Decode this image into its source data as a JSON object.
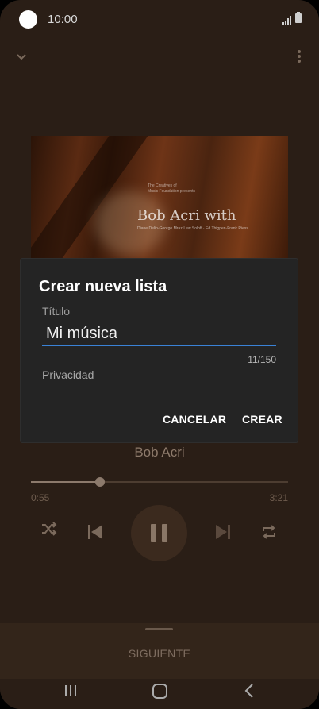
{
  "status_bar": {
    "time": "10:00"
  },
  "album": {
    "small_text": "The Creatives of\nMusic Foundation presents",
    "title": "Bob Acri with",
    "credits": "Diane Delin·George Mraz·Lew Soloff · Ed Thigpen·Frank Riess"
  },
  "player": {
    "artist": "Bob Acri",
    "elapsed": "0:55",
    "total": "3:21",
    "progress_fraction": 0.27
  },
  "next_panel": {
    "label": "SIGUIENTE"
  },
  "dialog": {
    "title": "Crear nueva lista",
    "field_label": "Título",
    "input_value": "Mi música",
    "counter": "11/150",
    "privacy_label": "Privacidad",
    "cancel_label": "CANCELAR",
    "create_label": "CREAR"
  },
  "colors": {
    "accent": "#3a82d6",
    "background": "#2a1e16",
    "dialog": "#242424"
  },
  "icons": {
    "collapse": "chevron-down-icon",
    "more": "more-vertical-icon",
    "shuffle": "shuffle-icon",
    "previous": "skip-previous-icon",
    "pause": "pause-icon",
    "next": "skip-next-icon",
    "repeat": "repeat-icon"
  }
}
